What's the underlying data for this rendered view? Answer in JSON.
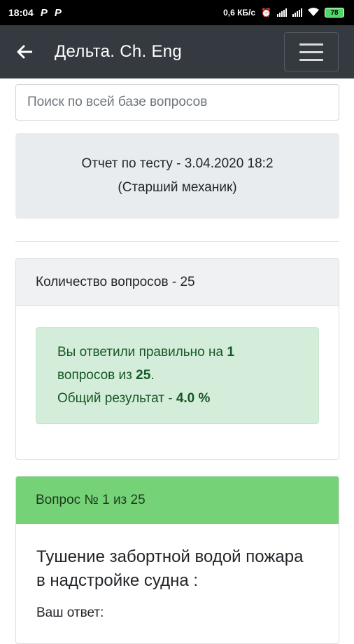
{
  "status_bar": {
    "time": "18:04",
    "speed": "0,6 КБ/с",
    "battery": "78"
  },
  "app_bar": {
    "title": "Дельта. Ch. Eng"
  },
  "search": {
    "placeholder": "Поиск по всей базе вопросов"
  },
  "report": {
    "line1": "Отчет по тесту - 3.04.2020 18:2",
    "line2": "(Старший механик)"
  },
  "summary_card": {
    "header": "Количество вопросов - 25",
    "answered_prefix": "Вы ответили правильно на ",
    "correct_count": "1",
    "questions_of": "вопросов из ",
    "total_count": "25",
    "period": ".",
    "result_prefix": "Общий результат - ",
    "result_value": "4.0 %"
  },
  "question_card": {
    "header": "Вопрос № 1 из 25",
    "question": "Тушение забортной водой пожара в надстройке судна :",
    "your_answer_label": "Ваш ответ:"
  }
}
